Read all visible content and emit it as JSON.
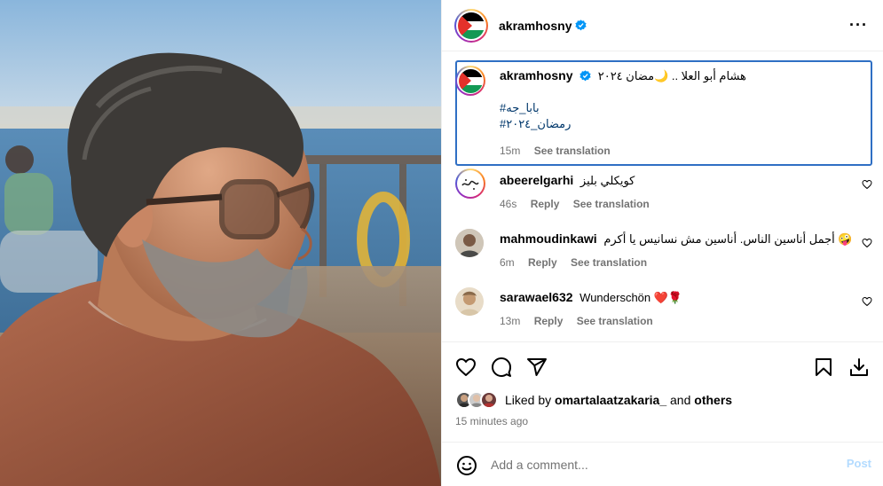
{
  "post": {
    "author": "akramhosny",
    "verified": true
  },
  "caption": {
    "author": "akramhosny",
    "text": "هشام أبو العلا .. 🌙مضان ٢٠٢٤",
    "hashtag1": "#بابا_جه",
    "hashtag2": "#رمضان_٢٠٢٤",
    "time": "15m",
    "see_translation": "See translation"
  },
  "comments": [
    {
      "username": "abeerelgarhi",
      "text": "كويكلي بليز",
      "time": "46s",
      "reply": "Reply",
      "see_translation": "See translation"
    },
    {
      "username": "mahmoudinkawi",
      "text": "أجمل أناسين الناس. أناسين مش نسانيس يا أكرم 🤪",
      "time": "6m",
      "reply": "Reply",
      "see_translation": "See translation"
    },
    {
      "username": "sarawael632",
      "text": "Wunderschön ❤️🌹",
      "time": "13m",
      "reply": "Reply",
      "see_translation": "See translation"
    }
  ],
  "likes": {
    "prefix": "Liked by",
    "user": "omartalaatzakaria_",
    "and": "and",
    "others": "others"
  },
  "time_ago": "15 minutes ago",
  "add_comment": {
    "placeholder": "Add a comment...",
    "post_label": "Post"
  },
  "icons": {
    "more": "more-options-icon",
    "like": "heart-icon",
    "comment": "comment-icon",
    "share": "share-icon",
    "save": "bookmark-icon",
    "download": "download-icon",
    "emoji": "emoji-icon",
    "verified": "verified-badge-icon"
  },
  "colors": {
    "verified": "#0095f6",
    "link": "#00376b",
    "post_disabled": "#b3dbff",
    "meta": "#737373",
    "caption_border": "#2f6fc4"
  }
}
